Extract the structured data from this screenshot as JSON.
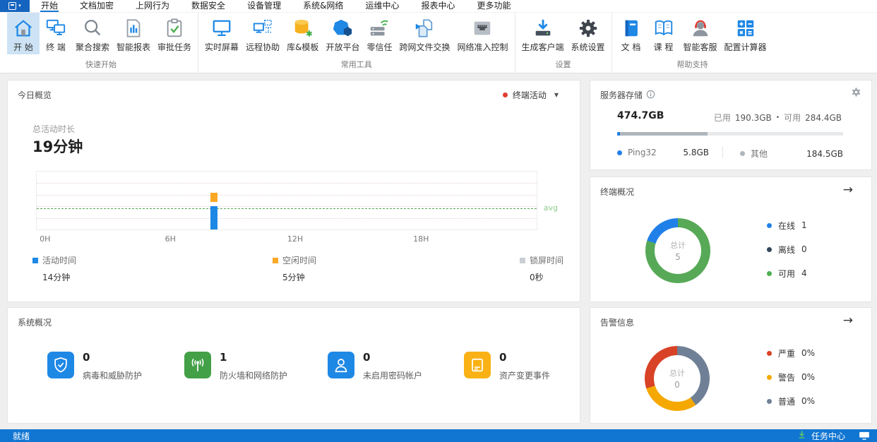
{
  "menubar": {
    "items": [
      "开始",
      "文档加密",
      "上网行为",
      "数据安全",
      "设备管理",
      "系统&网络",
      "运维中心",
      "报表中心",
      "更多功能"
    ],
    "active_index": 0
  },
  "ribbon": {
    "groups": [
      {
        "label": "快速开始",
        "items": [
          {
            "label": "开 始",
            "icon": "home",
            "active": true
          },
          {
            "label": "终 端",
            "icon": "terminals"
          },
          {
            "label": "聚合搜索",
            "icon": "search"
          },
          {
            "label": "智能报表",
            "icon": "report"
          },
          {
            "label": "审批任务",
            "icon": "approval"
          }
        ]
      },
      {
        "label": "常用工具",
        "items": [
          {
            "label": "实时屏幕",
            "icon": "screen"
          },
          {
            "label": "远程协助",
            "icon": "remote"
          },
          {
            "label": "库&模板",
            "icon": "library"
          },
          {
            "label": "开放平台",
            "icon": "platform"
          },
          {
            "label": "零信任",
            "icon": "zero-trust"
          },
          {
            "label": "跨网文件交换",
            "icon": "file-exchange"
          },
          {
            "label": "网络准入控制",
            "icon": "network-access"
          }
        ]
      },
      {
        "label": "设置",
        "items": [
          {
            "label": "生成客户端",
            "icon": "client-generate"
          },
          {
            "label": "系统设置",
            "icon": "gear"
          }
        ]
      },
      {
        "label": "帮助支持",
        "items": [
          {
            "label": "文 档",
            "icon": "doc-book"
          },
          {
            "label": "课 程",
            "icon": "course-book"
          },
          {
            "label": "智能客服",
            "icon": "support"
          },
          {
            "label": "配置计算器",
            "icon": "calculator"
          }
        ]
      }
    ]
  },
  "today": {
    "title": "今日概览",
    "filter": {
      "label": "终端活动",
      "dot_color": "#e23c32",
      "caret": "▼"
    },
    "total_label": "总活动时长",
    "total_value": "19分钟",
    "chart_data": {
      "type": "bar",
      "x_unit": "hour",
      "x_range": [
        0,
        24
      ],
      "x_ticks": [
        {
          "label": "0H",
          "pct": 1.8
        },
        {
          "label": "6H",
          "pct": 26.8
        },
        {
          "label": "12H",
          "pct": 51.7
        },
        {
          "label": "18H",
          "pct": 76.8
        }
      ],
      "series": [
        {
          "name": "活动时间",
          "color": "#1e88e5",
          "data": [
            {
              "hour": 8,
              "minutes": 14
            }
          ]
        },
        {
          "name": "空闲时间",
          "color": "#f9a825",
          "data": [
            {
              "hour": 8,
              "minutes": 5
            }
          ]
        },
        {
          "name": "锁屏时间",
          "color": "#c9ced3",
          "data": []
        }
      ],
      "bars_display": [
        {
          "color": "#f9a825",
          "left_pct": 34.8,
          "bottom_pct": 47,
          "height_pct": 17
        },
        {
          "color": "#1e88e5",
          "left_pct": 34.8,
          "bottom_pct": 0,
          "height_pct": 40
        }
      ],
      "grid_pcts": [
        20,
        40,
        60,
        80
      ],
      "avg_line": {
        "label": "avg",
        "color": "#53a654",
        "bottom_pct": 35
      }
    },
    "legend": [
      {
        "label": "活动时间",
        "value": "14分钟",
        "color": "#1e88e5"
      },
      {
        "label": "空闲时间",
        "value": "5分钟",
        "color": "#f9a825"
      },
      {
        "label": "锁屏时间",
        "value": "0秒",
        "color": "#c9ced3"
      }
    ]
  },
  "storage": {
    "title": "服务器存储",
    "total": "474.7GB",
    "used_label": "已用",
    "used_value": "190.3GB",
    "sep": "•",
    "free_label": "可用",
    "free_value": "284.4GB",
    "bar_segments": [
      {
        "color": "#2180e8",
        "pct": 1.3
      },
      {
        "color": "#aeb6bd",
        "pct": 38.8
      },
      {
        "color": "#e7e9eb",
        "pct": 59.9
      }
    ],
    "items": [
      {
        "label": "Ping32",
        "value": "5.8GB",
        "color": "#2180e8"
      },
      {
        "label": "其他",
        "value": "184.5GB",
        "color": "#aeb6bd"
      }
    ]
  },
  "terminal": {
    "title": "终端概况",
    "arrow": "→",
    "center_label": "总计",
    "center_value": "5",
    "legend": [
      {
        "label": "在线",
        "value": "1",
        "color": "#2180e8"
      },
      {
        "label": "离线",
        "value": "0",
        "color": "#33475b"
      },
      {
        "label": "可用",
        "value": "4",
        "color": "#4caf50"
      }
    ],
    "chart_data": {
      "type": "pie",
      "total": 5,
      "slices": [
        {
          "label": "在线",
          "value": 1,
          "color": "#2180e8"
        },
        {
          "label": "离线",
          "value": 0,
          "color": "#33475b"
        },
        {
          "label": "可用",
          "value": 4,
          "color": "#57a957"
        }
      ],
      "display_segments": [
        {
          "color": "#57a957",
          "from": 0,
          "to": 288
        },
        {
          "color": "#2180e8",
          "from": 288,
          "to": 360
        }
      ]
    }
  },
  "system": {
    "title": "系统概况",
    "items": [
      {
        "value": "0",
        "label": "病毒和威胁防护",
        "color": "#1e88e5",
        "icon": "shield-check"
      },
      {
        "value": "1",
        "label": "防火墙和网络防护",
        "color": "#43a047",
        "icon": "firewall-antenna"
      },
      {
        "value": "0",
        "label": "未启用密码帐户",
        "color": "#1e88e5",
        "icon": "user"
      },
      {
        "value": "0",
        "label": "资产变更事件",
        "color": "#f9b115",
        "icon": "asset-device"
      }
    ]
  },
  "alerts": {
    "title": "告警信息",
    "arrow": "→",
    "center_label": "总计",
    "center_value": "0",
    "legend": [
      {
        "label": "严重",
        "value": "0%",
        "color": "#d84226"
      },
      {
        "label": "警告",
        "value": "0%",
        "color": "#f5a800"
      },
      {
        "label": "普通",
        "value": "0%",
        "color": "#6f8096"
      }
    ],
    "chart_data": {
      "type": "pie",
      "total": 0,
      "slices": [
        {
          "label": "严重",
          "pct": 0,
          "color": "#d84226"
        },
        {
          "label": "警告",
          "pct": 0,
          "color": "#f5a800"
        },
        {
          "label": "普通",
          "pct": 0,
          "color": "#6f8096"
        }
      ],
      "display_segments": [
        {
          "color": "#6f8096",
          "from": 0,
          "to": 145
        },
        {
          "color": "#f5a800",
          "from": 145,
          "to": 252
        },
        {
          "color": "#d84226",
          "from": 252,
          "to": 360
        }
      ]
    }
  },
  "statusbar": {
    "ready": "就绪",
    "task_center": "任务中心"
  }
}
